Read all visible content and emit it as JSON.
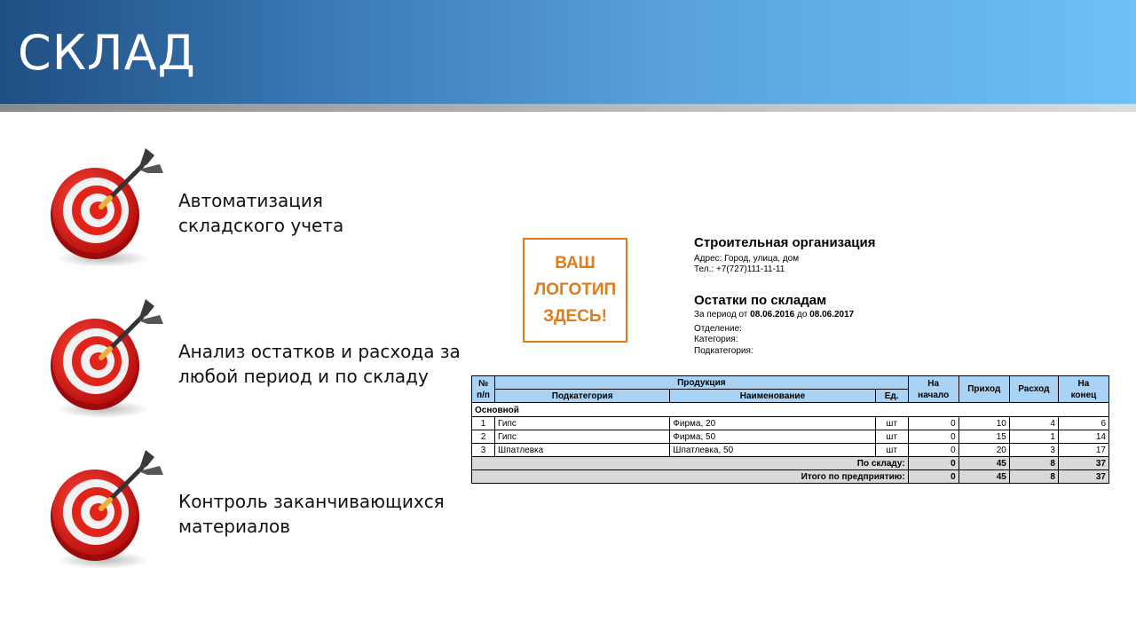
{
  "slide": {
    "title": "СКЛАД"
  },
  "bullets": [
    {
      "text": "Автоматизация\nскладского учета",
      "icon": "target-dart-icon"
    },
    {
      "text": "Анализ остатков и расхода за\nлюбой период и по складу",
      "icon": "target-dart-icon"
    },
    {
      "text": "Контроль заканчивающихся\nматериалов",
      "icon": "target-dart-icon"
    }
  ],
  "report": {
    "logo_text": "ВАШ\nЛОГОТИП\nЗДЕСЬ!",
    "org_name": "Строительная организация",
    "address": "Адрес: Город, улица, дом",
    "phone": "Тел.: +7(727)111-11-11",
    "title": "Остатки по складам",
    "period_prefix": "За период от ",
    "period_from": "08.06.2016",
    "period_mid": " до ",
    "period_to": "08.06.2017",
    "department": "Отделение:",
    "category": "Категория:",
    "subcategory": "Подкатегория:",
    "columns": {
      "num": "№\nп/п",
      "product": "Продукция",
      "subcat": "Подкатегория",
      "name": "Наименование",
      "unit": "Ед.",
      "start": "На\nначало",
      "income": "Приход",
      "expense": "Расход",
      "end": "На\nконец"
    },
    "group": "Основной",
    "rows": [
      {
        "n": "1",
        "subcat": "Гипс",
        "name": "Фирма, 20",
        "unit": "шт",
        "start": "0",
        "income": "10",
        "expense": "4",
        "end": "6"
      },
      {
        "n": "2",
        "subcat": "Гипс",
        "name": "Фирма, 50",
        "unit": "шт",
        "start": "0",
        "income": "15",
        "expense": "1",
        "end": "14"
      },
      {
        "n": "3",
        "subcat": "Шпатлевка",
        "name": "Шпатлевка, 50",
        "unit": "шт",
        "start": "0",
        "income": "20",
        "expense": "3",
        "end": "17"
      }
    ],
    "totals": [
      {
        "label": "По складу:",
        "start": "0",
        "income": "45",
        "expense": "8",
        "end": "37"
      },
      {
        "label": "Итого по предприятию:",
        "start": "0",
        "income": "45",
        "expense": "8",
        "end": "37"
      }
    ]
  },
  "colors": {
    "header_dark": "#1f4f82",
    "header_light": "#6ec0f6",
    "logo_orange": "#e07b1a",
    "table_header": "#a9d3f5"
  }
}
